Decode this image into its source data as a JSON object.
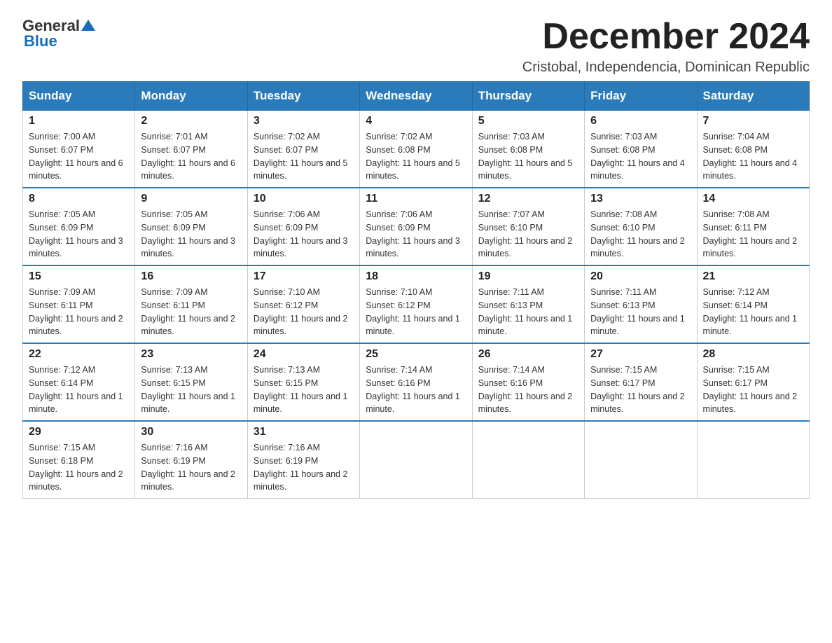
{
  "logo": {
    "general": "General",
    "blue": "Blue"
  },
  "header": {
    "month": "December 2024",
    "location": "Cristobal, Independencia, Dominican Republic"
  },
  "days_of_week": [
    "Sunday",
    "Monday",
    "Tuesday",
    "Wednesday",
    "Thursday",
    "Friday",
    "Saturday"
  ],
  "weeks": [
    [
      {
        "day": "1",
        "sunrise": "7:00 AM",
        "sunset": "6:07 PM",
        "daylight": "11 hours and 6 minutes."
      },
      {
        "day": "2",
        "sunrise": "7:01 AM",
        "sunset": "6:07 PM",
        "daylight": "11 hours and 6 minutes."
      },
      {
        "day": "3",
        "sunrise": "7:02 AM",
        "sunset": "6:07 PM",
        "daylight": "11 hours and 5 minutes."
      },
      {
        "day": "4",
        "sunrise": "7:02 AM",
        "sunset": "6:08 PM",
        "daylight": "11 hours and 5 minutes."
      },
      {
        "day": "5",
        "sunrise": "7:03 AM",
        "sunset": "6:08 PM",
        "daylight": "11 hours and 5 minutes."
      },
      {
        "day": "6",
        "sunrise": "7:03 AM",
        "sunset": "6:08 PM",
        "daylight": "11 hours and 4 minutes."
      },
      {
        "day": "7",
        "sunrise": "7:04 AM",
        "sunset": "6:08 PM",
        "daylight": "11 hours and 4 minutes."
      }
    ],
    [
      {
        "day": "8",
        "sunrise": "7:05 AM",
        "sunset": "6:09 PM",
        "daylight": "11 hours and 3 minutes."
      },
      {
        "day": "9",
        "sunrise": "7:05 AM",
        "sunset": "6:09 PM",
        "daylight": "11 hours and 3 minutes."
      },
      {
        "day": "10",
        "sunrise": "7:06 AM",
        "sunset": "6:09 PM",
        "daylight": "11 hours and 3 minutes."
      },
      {
        "day": "11",
        "sunrise": "7:06 AM",
        "sunset": "6:09 PM",
        "daylight": "11 hours and 3 minutes."
      },
      {
        "day": "12",
        "sunrise": "7:07 AM",
        "sunset": "6:10 PM",
        "daylight": "11 hours and 2 minutes."
      },
      {
        "day": "13",
        "sunrise": "7:08 AM",
        "sunset": "6:10 PM",
        "daylight": "11 hours and 2 minutes."
      },
      {
        "day": "14",
        "sunrise": "7:08 AM",
        "sunset": "6:11 PM",
        "daylight": "11 hours and 2 minutes."
      }
    ],
    [
      {
        "day": "15",
        "sunrise": "7:09 AM",
        "sunset": "6:11 PM",
        "daylight": "11 hours and 2 minutes."
      },
      {
        "day": "16",
        "sunrise": "7:09 AM",
        "sunset": "6:11 PM",
        "daylight": "11 hours and 2 minutes."
      },
      {
        "day": "17",
        "sunrise": "7:10 AM",
        "sunset": "6:12 PM",
        "daylight": "11 hours and 2 minutes."
      },
      {
        "day": "18",
        "sunrise": "7:10 AM",
        "sunset": "6:12 PM",
        "daylight": "11 hours and 1 minute."
      },
      {
        "day": "19",
        "sunrise": "7:11 AM",
        "sunset": "6:13 PM",
        "daylight": "11 hours and 1 minute."
      },
      {
        "day": "20",
        "sunrise": "7:11 AM",
        "sunset": "6:13 PM",
        "daylight": "11 hours and 1 minute."
      },
      {
        "day": "21",
        "sunrise": "7:12 AM",
        "sunset": "6:14 PM",
        "daylight": "11 hours and 1 minute."
      }
    ],
    [
      {
        "day": "22",
        "sunrise": "7:12 AM",
        "sunset": "6:14 PM",
        "daylight": "11 hours and 1 minute."
      },
      {
        "day": "23",
        "sunrise": "7:13 AM",
        "sunset": "6:15 PM",
        "daylight": "11 hours and 1 minute."
      },
      {
        "day": "24",
        "sunrise": "7:13 AM",
        "sunset": "6:15 PM",
        "daylight": "11 hours and 1 minute."
      },
      {
        "day": "25",
        "sunrise": "7:14 AM",
        "sunset": "6:16 PM",
        "daylight": "11 hours and 1 minute."
      },
      {
        "day": "26",
        "sunrise": "7:14 AM",
        "sunset": "6:16 PM",
        "daylight": "11 hours and 2 minutes."
      },
      {
        "day": "27",
        "sunrise": "7:15 AM",
        "sunset": "6:17 PM",
        "daylight": "11 hours and 2 minutes."
      },
      {
        "day": "28",
        "sunrise": "7:15 AM",
        "sunset": "6:17 PM",
        "daylight": "11 hours and 2 minutes."
      }
    ],
    [
      {
        "day": "29",
        "sunrise": "7:15 AM",
        "sunset": "6:18 PM",
        "daylight": "11 hours and 2 minutes."
      },
      {
        "day": "30",
        "sunrise": "7:16 AM",
        "sunset": "6:19 PM",
        "daylight": "11 hours and 2 minutes."
      },
      {
        "day": "31",
        "sunrise": "7:16 AM",
        "sunset": "6:19 PM",
        "daylight": "11 hours and 2 minutes."
      },
      null,
      null,
      null,
      null
    ]
  ]
}
